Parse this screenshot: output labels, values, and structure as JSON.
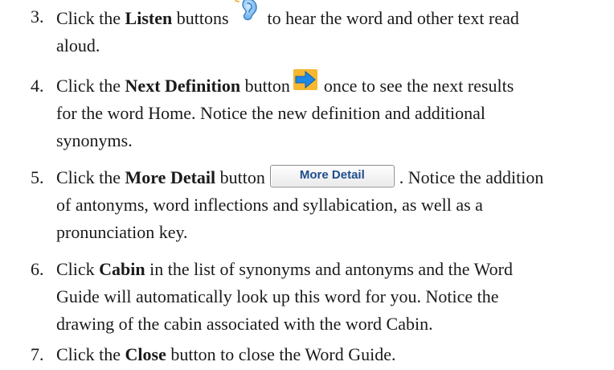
{
  "steps": [
    {
      "number": "3.",
      "lines": [
        {
          "before": "Click the ",
          "bold": "Listen",
          "after": " buttons",
          "icon": "ear-icon",
          "after_icon": "to hear the word and other text read"
        },
        {
          "text": "aloud."
        }
      ]
    },
    {
      "number": "4.",
      "lines": [
        {
          "before": "Click the ",
          "bold": "Next Definition",
          "after": " button",
          "icon": "right-arrow-icon",
          "after_icon": "once to see the next results"
        },
        {
          "text": "for the word Home. Notice the new definition and additional"
        },
        {
          "text": "synonyms."
        }
      ]
    },
    {
      "number": "5.",
      "lines": [
        {
          "before": "Click the ",
          "bold": "More Detail",
          "after": " button",
          "button_label": "More Detail",
          "after_icon": ". Notice the addition"
        },
        {
          "text": "of antonyms, word inflections and syllabication, as well as a"
        },
        {
          "text": "pronunciation key."
        }
      ]
    },
    {
      "number": "6.",
      "lines": [
        {
          "before": "Click ",
          "bold": "Cabin",
          "after": " in the list of synonyms and antonyms and the Word"
        },
        {
          "text": "Guide will automatically look up this word for you. Notice the"
        },
        {
          "text": "drawing of the cabin associated with the word Cabin."
        }
      ]
    },
    {
      "number": "7.",
      "lines": [
        {
          "before": "Click the ",
          "bold": "Close",
          "after": " button to close the Word Guide."
        }
      ]
    }
  ],
  "colors": {
    "ear_blue": "#5aa6e6",
    "arrow_blue": "#1e88e5",
    "arrow_bg": "#f7b731",
    "button_text": "#1f4e8c"
  }
}
